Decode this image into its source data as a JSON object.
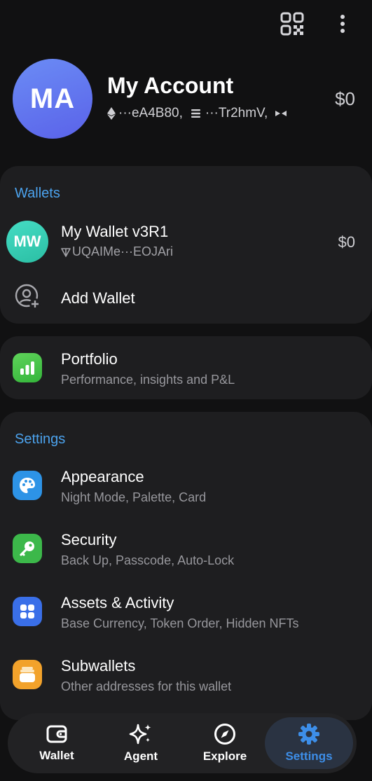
{
  "header": {
    "qr_icon": "qr-code-icon",
    "more_icon": "more-vertical-icon"
  },
  "account": {
    "initials": "MA",
    "name": "My Account",
    "address_eth": "···eA4B80,",
    "address_ton": "···Tr2hmV,",
    "balance": "$0",
    "avatar_color": "#5f74ee"
  },
  "wallets": {
    "title": "Wallets",
    "item": {
      "initials": "MW",
      "name": "My Wallet v3R1",
      "address": "UQAIMe···EOJAri",
      "balance": "$0",
      "avatar_color": "#33c9ae"
    },
    "add_label": "Add Wallet"
  },
  "portfolio": {
    "title": "Portfolio",
    "subtitle": "Performance, insights and P&L",
    "icon_color": "#45c447"
  },
  "settings": {
    "title": "Settings",
    "items": [
      {
        "title": "Appearance",
        "subtitle": "Night Mode, Palette, Card",
        "icon": "palette-icon",
        "color": "#2d93e6"
      },
      {
        "title": "Security",
        "subtitle": "Back Up, Passcode, Auto-Lock",
        "icon": "key-icon",
        "color": "#3cb84a"
      },
      {
        "title": "Assets & Activity",
        "subtitle": "Base Currency, Token Order, Hidden NFTs",
        "icon": "grid-icon",
        "color": "#3a6fe8"
      },
      {
        "title": "Subwallets",
        "subtitle": "Other addresses for this wallet",
        "icon": "stack-icon",
        "color": "#f2a22b"
      }
    ]
  },
  "tabbar": {
    "tabs": [
      {
        "label": "Wallet",
        "icon": "wallet-icon",
        "active": false
      },
      {
        "label": "Agent",
        "icon": "sparkle-icon",
        "active": false
      },
      {
        "label": "Explore",
        "icon": "compass-icon",
        "active": false
      },
      {
        "label": "Settings",
        "icon": "gear-icon",
        "active": true
      }
    ],
    "accent": "#3d8ee8"
  }
}
